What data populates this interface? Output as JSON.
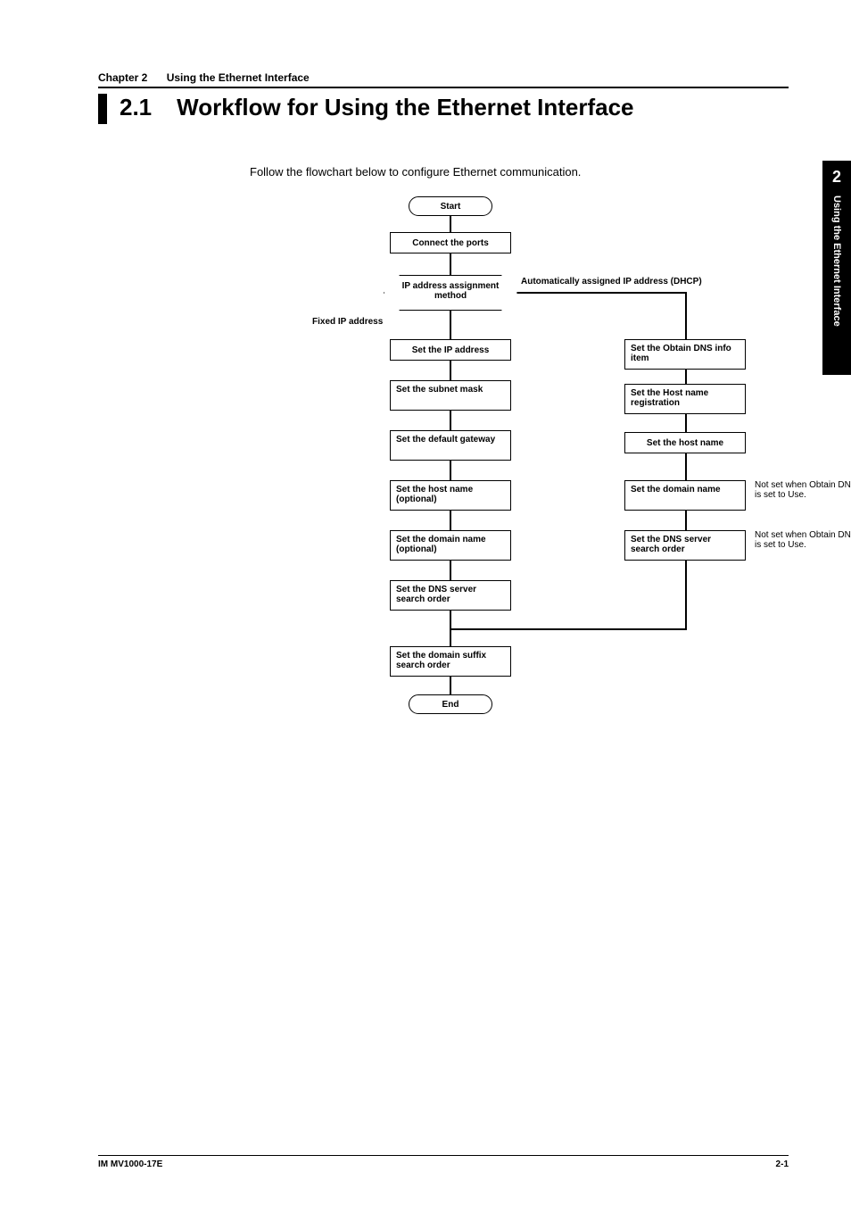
{
  "chapter": {
    "number": "Chapter 2",
    "title": "Using the Ethernet Interface"
  },
  "section": {
    "number": "2.1",
    "title": "Workflow for Using the Ethernet Interface"
  },
  "intro": "Follow the flowchart below to configure Ethernet communication.",
  "tab": {
    "number": "2",
    "label": "Using the Ethernet Interface"
  },
  "flow": {
    "start": "Start",
    "connect": "Connect the ports",
    "decision": "IP address assignment method",
    "branch_left_label": "Fixed IP address",
    "branch_right_label": "Automatically assigned IP address (DHCP)",
    "left": {
      "a": "Set the IP address",
      "b": "Set the subnet mask",
      "c": "Set the default gateway",
      "d": "Set the host name (optional)",
      "e": "Set the domain name (optional)",
      "f": "Set the DNS server search order",
      "g": "Set the domain suffix search order"
    },
    "right": {
      "a": "Set the Obtain DNS info item",
      "b": "Set the Host name registration",
      "c": "Set the host name",
      "d": "Set the domain name",
      "e": "Set the DNS server search order"
    },
    "end": "End",
    "note1": "Not set when Obtain DNS info is set to Use.",
    "note2": "Not set when Obtain DNS info is set to Use."
  },
  "footer": {
    "left": "IM MV1000-17E",
    "right": "2-1"
  }
}
